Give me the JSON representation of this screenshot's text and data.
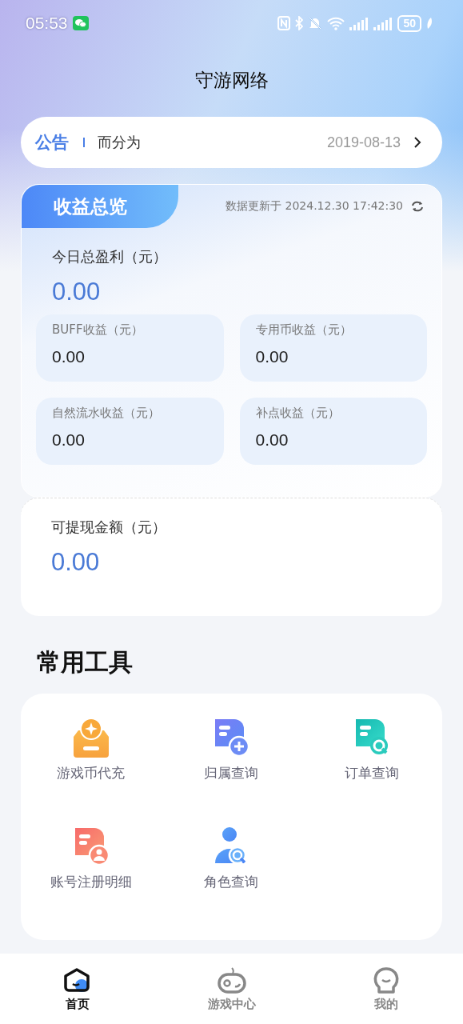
{
  "status_bar": {
    "time": "05:53",
    "battery": "50"
  },
  "title": "守游网络",
  "notice": {
    "tag": "公告",
    "text": "而分为",
    "date": "2019-08-13"
  },
  "overview": {
    "title": "收益总览",
    "updated": "数据更新于 2024.12.30 17:42:30",
    "total_label": "今日总盈利（元）",
    "total_value": "0.00",
    "items": [
      {
        "label": "BUFF收益（元）",
        "value": "0.00"
      },
      {
        "label": "专用币收益（元）",
        "value": "0.00"
      },
      {
        "label": "自然流水收益（元）",
        "value": "0.00"
      },
      {
        "label": "补点收益（元）",
        "value": "0.00"
      }
    ]
  },
  "withdraw": {
    "label": "可提现金额（元）",
    "value": "0.00"
  },
  "tools": {
    "title": "常用工具",
    "items": [
      {
        "kind": "coin",
        "label": "游戏币代充"
      },
      {
        "kind": "doc-plus",
        "label": "归属查询"
      },
      {
        "kind": "doc-search",
        "label": "订单查询"
      },
      {
        "kind": "doc-person",
        "label": "账号注册明细"
      },
      {
        "kind": "person-search",
        "label": "角色查询"
      }
    ]
  },
  "tab_bar": [
    {
      "kind": "home",
      "label": "首页",
      "selected": true
    },
    {
      "kind": "game",
      "label": "游戏中心",
      "selected": false
    },
    {
      "kind": "me",
      "label": "我的",
      "selected": false
    }
  ]
}
